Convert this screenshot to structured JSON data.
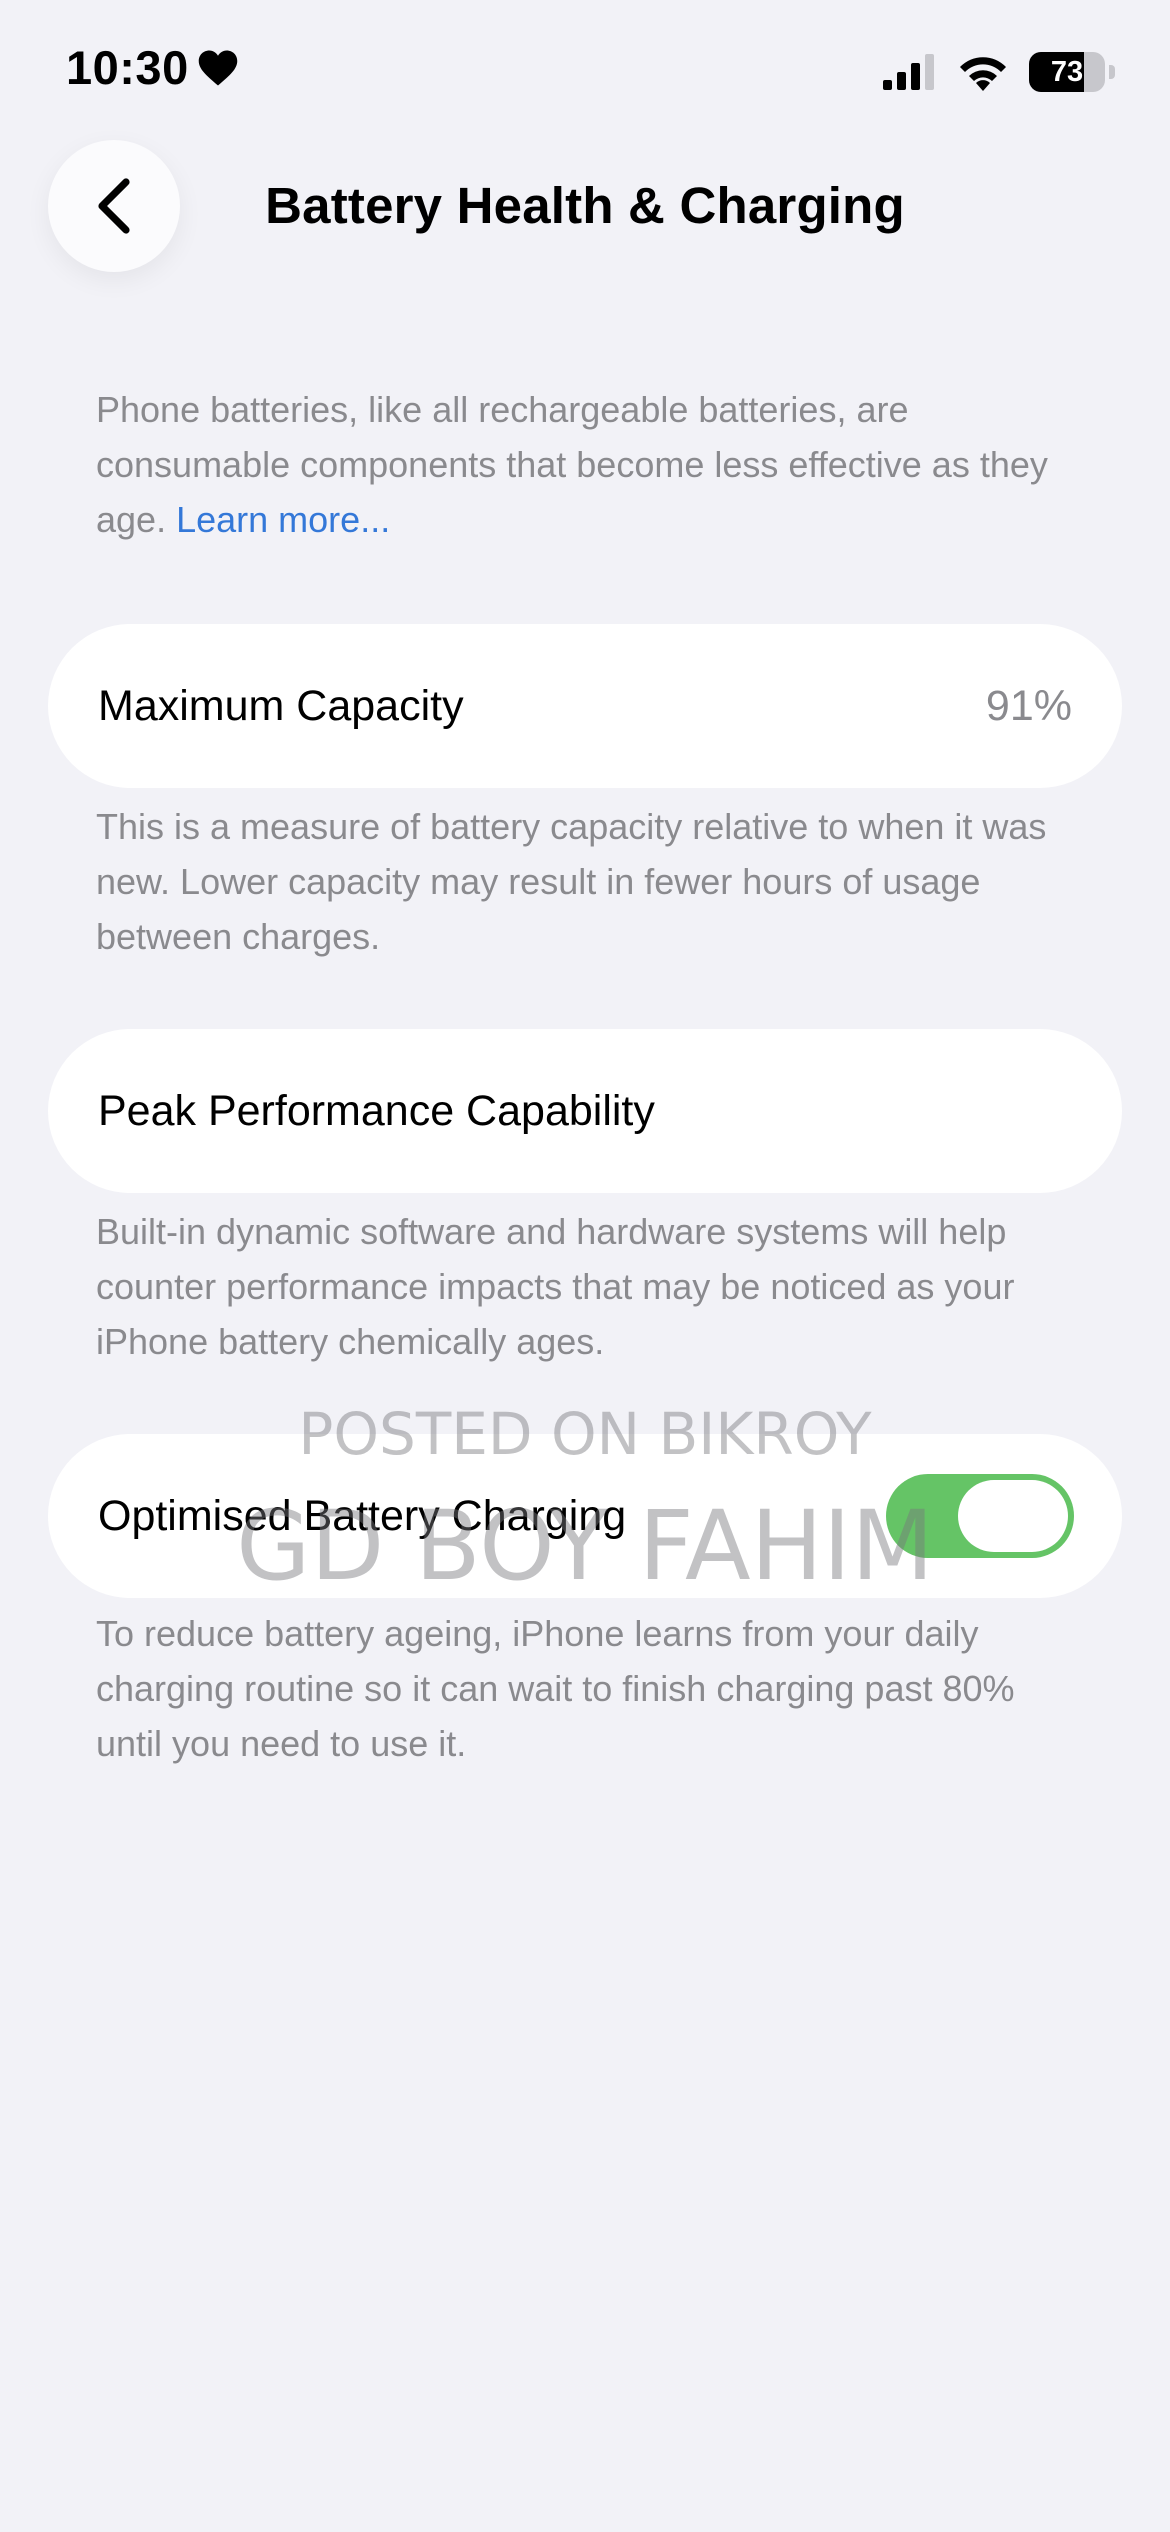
{
  "status_bar": {
    "time": "10:30",
    "heart_icon": "heart-icon",
    "signal_icon": "cellular-signal-icon",
    "wifi_icon": "wifi-icon",
    "battery_level": "73",
    "battery_fraction": 0.73
  },
  "nav": {
    "back_icon": "chevron-left-icon",
    "title": "Battery Health & Charging"
  },
  "intro": {
    "text": "Phone batteries, like all rechargeable batteries, are consumable components that become less effective as they age.",
    "link": "Learn more..."
  },
  "max_capacity": {
    "label": "Maximum Capacity",
    "value": "91%",
    "description": "This is a measure of battery capacity relative to when it was new. Lower capacity may result in fewer hours of usage between charges."
  },
  "peak_performance": {
    "label": "Peak Performance Capability",
    "description": "Built-in dynamic software and hardware systems will help counter performance impacts that may be noticed as your iPhone battery chemically ages."
  },
  "optimised_charging": {
    "label": "Optimised Battery Charging",
    "enabled": true,
    "description": "To reduce battery ageing, iPhone learns from your daily charging routine so it can wait to finish charging past 80% until you need to use it."
  },
  "watermark": {
    "line1": "POSTED ON BIKROY",
    "line2": "GD BOY FAHIM"
  },
  "colors": {
    "background": "#f2f2f7",
    "link": "#3478d8",
    "toggle_on": "#65c466",
    "secondary_text": "#8a8a8e"
  }
}
